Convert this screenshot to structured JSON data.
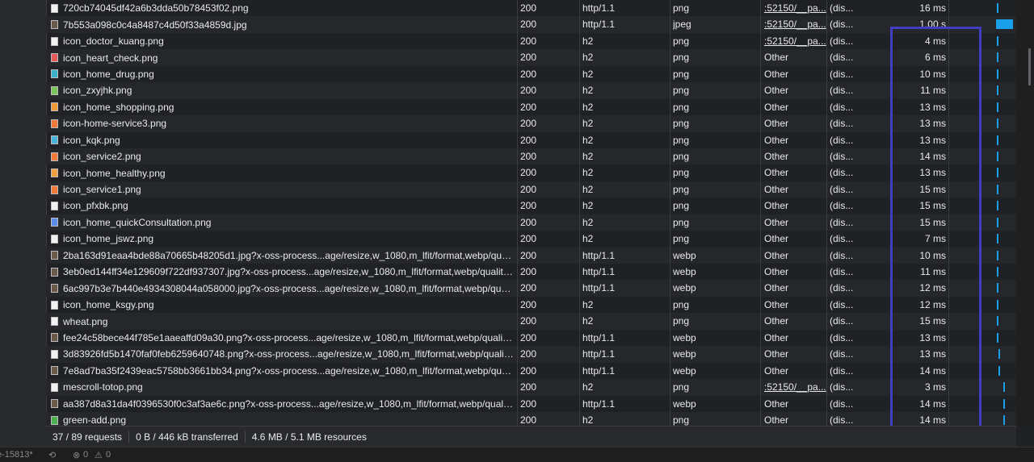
{
  "rows": [
    {
      "name": "720cb74045df42a6b3dda50b78453f02.png",
      "status": "200",
      "protocol": "http/1.1",
      "type": "png",
      "initiator": ":52150/__pa...",
      "size": "(dis...",
      "time": "16 ms",
      "icon": "file-image-icon"
    },
    {
      "name": "7b553a098c0c4a8487c4d50f33a4859d.jpg",
      "status": "200",
      "protocol": "http/1.1",
      "type": "jpeg",
      "initiator": ":52150/__pa...",
      "size": "(dis...",
      "time": "1.00 s",
      "icon": "photo-thumbnail-icon"
    },
    {
      "name": "icon_doctor_kuang.png",
      "status": "200",
      "protocol": "h2",
      "type": "png",
      "initiator": ":52150/__pa...",
      "size": "(dis...",
      "time": "4 ms",
      "icon": "file-image-icon"
    },
    {
      "name": "icon_heart_check.png",
      "status": "200",
      "protocol": "h2",
      "type": "png",
      "initiator": "Other",
      "size": "(dis...",
      "time": "6 ms",
      "icon": "heart-icon"
    },
    {
      "name": "icon_home_drug.png",
      "status": "200",
      "protocol": "h2",
      "type": "png",
      "initiator": "Other",
      "size": "(dis...",
      "time": "10 ms",
      "icon": "drug-icon"
    },
    {
      "name": "icon_zxyjhk.png",
      "status": "200",
      "protocol": "h2",
      "type": "png",
      "initiator": "Other",
      "size": "(dis...",
      "time": "11 ms",
      "icon": "leaf-icon"
    },
    {
      "name": "icon_home_shopping.png",
      "status": "200",
      "protocol": "h2",
      "type": "png",
      "initiator": "Other",
      "size": "(dis...",
      "time": "13 ms",
      "icon": "shopping-icon"
    },
    {
      "name": "icon-home-service3.png",
      "status": "200",
      "protocol": "h2",
      "type": "png",
      "initiator": "Other",
      "size": "(dis...",
      "time": "13 ms",
      "icon": "service-icon"
    },
    {
      "name": "icon_kqk.png",
      "status": "200",
      "protocol": "h2",
      "type": "png",
      "initiator": "Other",
      "size": "(dis...",
      "time": "13 ms",
      "icon": "tooth-icon"
    },
    {
      "name": "icon_service2.png",
      "status": "200",
      "protocol": "h2",
      "type": "png",
      "initiator": "Other",
      "size": "(dis...",
      "time": "14 ms",
      "icon": "service-icon"
    },
    {
      "name": "icon_home_healthy.png",
      "status": "200",
      "protocol": "h2",
      "type": "png",
      "initiator": "Other",
      "size": "(dis...",
      "time": "13 ms",
      "icon": "health-icon"
    },
    {
      "name": "icon_service1.png",
      "status": "200",
      "protocol": "h2",
      "type": "png",
      "initiator": "Other",
      "size": "(dis...",
      "time": "15 ms",
      "icon": "service-icon"
    },
    {
      "name": "icon_pfxbk.png",
      "status": "200",
      "protocol": "h2",
      "type": "png",
      "initiator": "Other",
      "size": "(dis...",
      "time": "15 ms",
      "icon": "file-image-icon"
    },
    {
      "name": "icon_home_quickConsultation.png",
      "status": "200",
      "protocol": "h2",
      "type": "png",
      "initiator": "Other",
      "size": "(dis...",
      "time": "15 ms",
      "icon": "consultation-icon"
    },
    {
      "name": "icon_home_jswz.png",
      "status": "200",
      "protocol": "h2",
      "type": "png",
      "initiator": "Other",
      "size": "(dis...",
      "time": "7 ms",
      "icon": "file-image-icon"
    },
    {
      "name": "2ba163d91eaa4bde88a70665b48205d1.jpg?x-oss-process...age/resize,w_1080,m_lfit/format,webp/quality,...",
      "status": "200",
      "protocol": "http/1.1",
      "type": "webp",
      "initiator": "Other",
      "size": "(dis...",
      "time": "10 ms",
      "icon": "photo-thumbnail-icon"
    },
    {
      "name": "3eb0ed144ff34e129609f722df937307.jpg?x-oss-process...age/resize,w_1080,m_lfit/format,webp/quality,q_75",
      "status": "200",
      "protocol": "http/1.1",
      "type": "webp",
      "initiator": "Other",
      "size": "(dis...",
      "time": "11 ms",
      "icon": "photo-thumbnail-icon"
    },
    {
      "name": "6ac997b3e7b440e4934308044a058000.jpg?x-oss-process...age/resize,w_1080,m_lfit/format,webp/quality,q...",
      "status": "200",
      "protocol": "http/1.1",
      "type": "webp",
      "initiator": "Other",
      "size": "(dis...",
      "time": "12 ms",
      "icon": "photo-thumbnail-icon"
    },
    {
      "name": "icon_home_ksgy.png",
      "status": "200",
      "protocol": "h2",
      "type": "png",
      "initiator": "Other",
      "size": "(dis...",
      "time": "12 ms",
      "icon": "file-image-icon"
    },
    {
      "name": "wheat.png",
      "status": "200",
      "protocol": "h2",
      "type": "png",
      "initiator": "Other",
      "size": "(dis...",
      "time": "15 ms",
      "icon": "file-image-icon"
    },
    {
      "name": "fee24c58bece44f785e1aaeaffd09a30.png?x-oss-process...age/resize,w_1080,m_lfit/format,webp/quality,q_75",
      "status": "200",
      "protocol": "http/1.1",
      "type": "webp",
      "initiator": "Other",
      "size": "(dis...",
      "time": "13 ms",
      "icon": "photo-thumbnail-icon"
    },
    {
      "name": "3d83926fd5b1470faf0feb6259640748.png?x-oss-process...age/resize,w_1080,m_lfit/format,webp/quality,q_...",
      "status": "200",
      "protocol": "http/1.1",
      "type": "webp",
      "initiator": "Other",
      "size": "(dis...",
      "time": "13 ms",
      "icon": "file-image-icon"
    },
    {
      "name": "7e8ad7ba35f2439eac5758bb3661bb34.png?x-oss-process...age/resize,w_1080,m_lfit/format,webp/quality,...",
      "status": "200",
      "protocol": "http/1.1",
      "type": "webp",
      "initiator": "Other",
      "size": "(dis...",
      "time": "14 ms",
      "icon": "photo-thumbnail-icon"
    },
    {
      "name": "mescroll-totop.png",
      "status": "200",
      "protocol": "h2",
      "type": "png",
      "initiator": ":52150/__pa...",
      "size": "(dis...",
      "time": "3 ms",
      "icon": "file-image-icon"
    },
    {
      "name": "aa387d8a31da4f0396530f0c3af3ae6c.png?x-oss-process...age/resize,w_1080,m_lfit/format,webp/quality,q_...",
      "status": "200",
      "protocol": "http/1.1",
      "type": "webp",
      "initiator": "Other",
      "size": "(dis...",
      "time": "14 ms",
      "icon": "photo-thumbnail-icon"
    },
    {
      "name": "green-add.png",
      "status": "200",
      "protocol": "h2",
      "type": "png",
      "initiator": "Other",
      "size": "(dis...",
      "time": "14 ms",
      "icon": "add-icon"
    }
  ],
  "summary": {
    "requests": "37 / 89 requests",
    "transferred": "0 B / 446 kB transferred",
    "resources": "4.6 MB / 5.1 MB resources"
  },
  "bottom": {
    "left_fragment": "e-15813*",
    "errors": "0",
    "warnings": "0"
  },
  "colors": {
    "accent": "#1a9fea",
    "highlight": "#3f3fc0",
    "background": "#202124"
  }
}
